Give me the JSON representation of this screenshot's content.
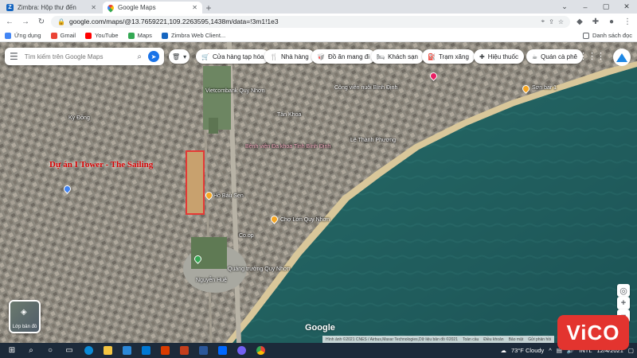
{
  "browser": {
    "tabs": [
      {
        "title": "Zimbra: Hộp thư đến",
        "icon": "zimbra-icon",
        "active": false
      },
      {
        "title": "Google Maps",
        "icon": "google-maps-icon",
        "active": true
      }
    ],
    "address": "google.com/maps/@13.7659221,109.2263595,1438m/data=!3m1!1e3",
    "bookmarks": [
      {
        "label": "Ứng dụng",
        "icon": "apps-grid-icon",
        "color": "#4285f4"
      },
      {
        "label": "Gmail",
        "icon": "gmail-icon",
        "color": "#ea4335"
      },
      {
        "label": "YouTube",
        "icon": "youtube-icon",
        "color": "#ff0000"
      },
      {
        "label": "Maps",
        "icon": "maps-icon",
        "color": "#34a853"
      },
      {
        "label": "Zimbra Web Client...",
        "icon": "zimbra-icon",
        "color": "#1565c0"
      }
    ],
    "reading_list": "Danh sách đọc"
  },
  "maps": {
    "search_placeholder": "Tìm kiếm trên Google Maps",
    "chips": [
      {
        "label": "Cửa hàng tạp hóa",
        "icon": "cart-icon"
      },
      {
        "label": "Nhà hàng",
        "icon": "fork-knife-icon"
      },
      {
        "label": "Đồ ăn mang đi",
        "icon": "takeout-icon"
      },
      {
        "label": "Khách sạn",
        "icon": "bed-icon"
      },
      {
        "label": "Trạm xăng",
        "icon": "gas-icon"
      },
      {
        "label": "Hiệu thuốc",
        "icon": "pharmacy-icon"
      },
      {
        "label": "Quán cà phê",
        "icon": "coffee-icon"
      }
    ],
    "project_label": "Dự án I Tower - The Sailing",
    "labels": {
      "vietcombank": "Vietcombank Quy Nhơn",
      "cong_vien": "Công viên nuôi Bình Định",
      "benh_vien": "Bệnh viện Đa khoa Tỉnh Bình Định",
      "ho_bau_sen": "Hồ Bàu Sen",
      "quang_truong": "Quảng trường Quy Nhơn",
      "tan_thanh": "Quảng trường Quy Nhơn",
      "cho_lon": "Chợ Lớn Quy Nhơn",
      "tan_khoa": "Tân Khoa",
      "phuoc_hai": "Lê Thành Phương",
      "ky_dong": "Kỳ Đồng",
      "son_bar": "Sơn bar 1",
      "coop": "Co.op",
      "nguyen_hue": "Nguyễn Huệ"
    },
    "layers_label": "Lớp bản đồ",
    "attribution": [
      "Hình ảnh ©2021 CNES / Airbus,Maxar Technologies,Dữ liệu bản đồ ©2021",
      "Toàn cầu",
      "Điều khoản",
      "Bảo mật",
      "Gửi phản hồi"
    ],
    "google": "Google"
  },
  "watermark": "ViCO",
  "taskbar": {
    "weather": "73°F  Cloudy",
    "lang": "INTL",
    "date": "12/4/2021"
  }
}
